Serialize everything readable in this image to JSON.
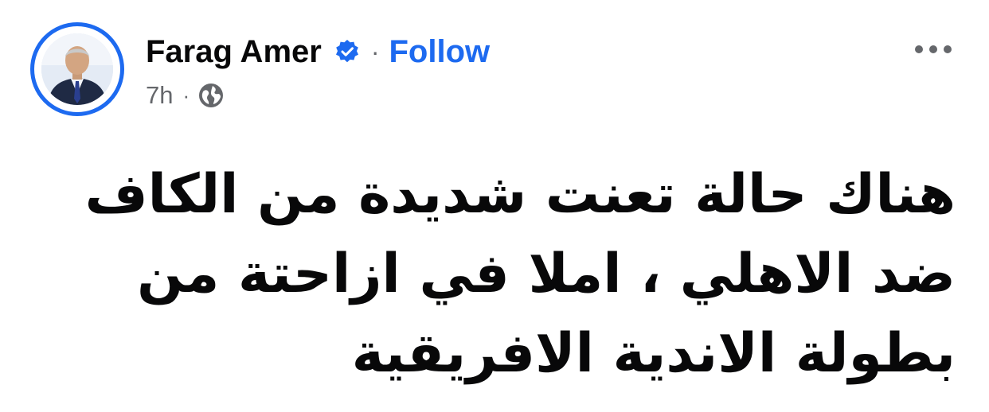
{
  "post": {
    "author": {
      "name": "Farag Amer",
      "verified": true,
      "follow_label": "Follow",
      "avatar_icon": "person-portrait"
    },
    "meta": {
      "time": "7h",
      "audience_icon": "globe-icon"
    },
    "menu_icon": "more-dots-icon",
    "text": "هناك حالة تعنت شديدة من الكاف ضد الاهلي ، املا في ازاحتة من بطولة الاندية الافريقية"
  },
  "colors": {
    "accent": "#1d6af0",
    "text": "#080809",
    "muted": "#65676b"
  }
}
